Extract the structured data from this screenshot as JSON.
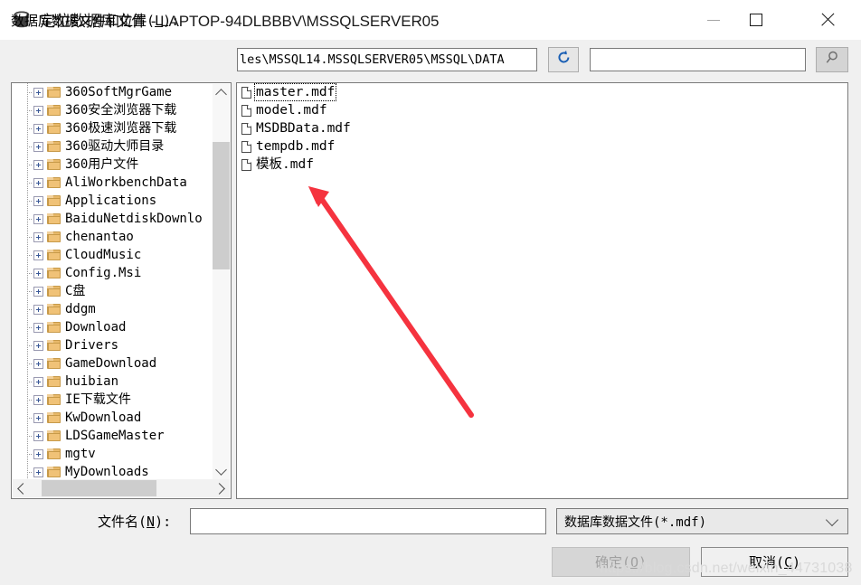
{
  "window": {
    "title": "定位数据库文件 - LAPTOP-94DLBBBV\\MSSQLSERVER05",
    "icon": "database-icon",
    "minimize_label": "—",
    "maximize_label": "□",
    "close_label": "✕"
  },
  "toolbar": {
    "location_label_prefix": "数据库数据文件和位置(",
    "location_label_key": "L",
    "location_label_suffix": "):",
    "path_value": "les\\MSSQL14.MSSQLSERVER05\\MSSQL\\DATA",
    "refresh_icon": "refresh-icon",
    "refresh_color": "#1a5fb4",
    "search_value": "",
    "search_placeholder": "",
    "search_icon": "magnifier-icon"
  },
  "tree": {
    "items": [
      {
        "label": "360SoftMgrGame"
      },
      {
        "label": "360安全浏览器下载"
      },
      {
        "label": "360极速浏览器下载"
      },
      {
        "label": "360驱动大师目录"
      },
      {
        "label": "360用户文件"
      },
      {
        "label": "AliWorkbenchData"
      },
      {
        "label": "Applications"
      },
      {
        "label": "BaiduNetdiskDownlo"
      },
      {
        "label": "chenantao"
      },
      {
        "label": "CloudMusic"
      },
      {
        "label": "Config.Msi"
      },
      {
        "label": "C盘"
      },
      {
        "label": "ddgm"
      },
      {
        "label": "Download"
      },
      {
        "label": "Drivers"
      },
      {
        "label": "GameDownload"
      },
      {
        "label": "huibian"
      },
      {
        "label": "IE下载文件"
      },
      {
        "label": "KwDownload"
      },
      {
        "label": "LDSGameMaster"
      },
      {
        "label": "mgtv"
      },
      {
        "label": "MyDownloads"
      }
    ],
    "scrollbar": {
      "up_icon": "chevron-up-icon",
      "down_icon": "chevron-down-icon",
      "left_icon": "chevron-left-icon",
      "right_icon": "chevron-right-icon"
    }
  },
  "files": {
    "items": [
      {
        "name": "master.mdf",
        "focused": true
      },
      {
        "name": "model.mdf",
        "focused": false
      },
      {
        "name": "MSDBData.mdf",
        "focused": false
      },
      {
        "name": "tempdb.mdf",
        "focused": false
      },
      {
        "name": "模板.mdf",
        "focused": false
      }
    ]
  },
  "annotation": {
    "arrow_color": "#f5333f",
    "arrow_name": "red-pointer-arrow"
  },
  "footer": {
    "filename_label_prefix": "文件名(",
    "filename_label_key": "N",
    "filename_label_suffix": "):",
    "filename_value": "",
    "filter_selected": "数据库数据文件(*.mdf)",
    "filter_chevron": "chevron-down-icon",
    "ok_label_prefix": "确定(",
    "ok_label_key": "O",
    "ok_label_suffix": ")",
    "cancel_label_prefix": "取消(",
    "cancel_label_key": "C",
    "cancel_label_suffix": ")"
  },
  "watermark": {
    "text": "https://blog.csdn.net/weixin_44731038"
  }
}
